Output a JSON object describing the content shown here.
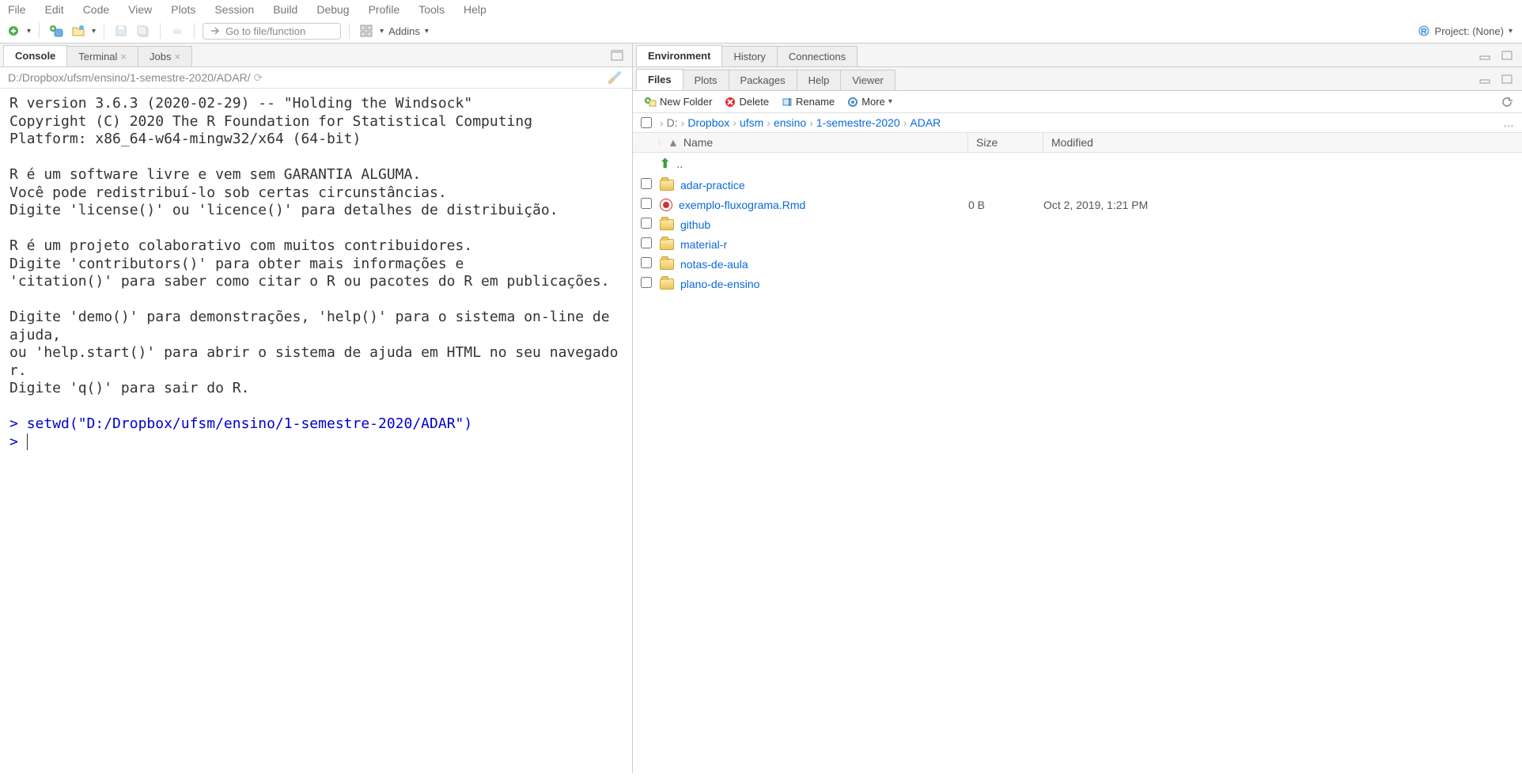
{
  "menubar": [
    "File",
    "Edit",
    "Code",
    "View",
    "Plots",
    "Session",
    "Build",
    "Debug",
    "Profile",
    "Tools",
    "Help"
  ],
  "toolbar": {
    "goto_placeholder": "Go to file/function",
    "addins": "Addins",
    "project": "Project: (None)"
  },
  "left": {
    "tabs": {
      "console": "Console",
      "terminal": "Terminal",
      "jobs": "Jobs"
    },
    "path": "D:/Dropbox/ufsm/ensino/1-semestre-2020/ADAR/",
    "console_text": "R version 3.6.3 (2020-02-29) -- \"Holding the Windsock\"\nCopyright (C) 2020 The R Foundation for Statistical Computing\nPlatform: x86_64-w64-mingw32/x64 (64-bit)\n\nR é um software livre e vem sem GARANTIA ALGUMA.\nVocê pode redistribuí-lo sob certas circunstâncias.\nDigite 'license()' ou 'licence()' para detalhes de distribuição.\n\nR é um projeto colaborativo com muitos contribuidores.\nDigite 'contributors()' para obter mais informações e\n'citation()' para saber como citar o R ou pacotes do R em publicações.\n\nDigite 'demo()' para demonstrações, 'help()' para o sistema on-line de ajuda,\nou 'help.start()' para abrir o sistema de ajuda em HTML no seu navegador.\nDigite 'q()' para sair do R.\n",
    "prompt1": "> ",
    "cmd1": "setwd(\"D:/Dropbox/ufsm/ensino/1-semestre-2020/ADAR\")",
    "prompt2": "> "
  },
  "right": {
    "top_tabs": {
      "env": "Environment",
      "hist": "History",
      "conn": "Connections"
    },
    "bot_tabs": {
      "files": "Files",
      "plots": "Plots",
      "packages": "Packages",
      "help": "Help",
      "viewer": "Viewer"
    },
    "file_btns": {
      "new": "New Folder",
      "delete": "Delete",
      "rename": "Rename",
      "more": "More"
    },
    "breadcrumb": [
      "D:",
      "Dropbox",
      "ufsm",
      "ensino",
      "1-semestre-2020",
      "ADAR"
    ],
    "headers": {
      "name": "Name",
      "size": "Size",
      "modified": "Modified"
    },
    "updir": "..",
    "rows": [
      {
        "type": "folder",
        "name": "adar-practice",
        "size": "",
        "modified": ""
      },
      {
        "type": "rmd",
        "name": "exemplo-fluxograma.Rmd",
        "size": "0 B",
        "modified": "Oct 2, 2019, 1:21 PM"
      },
      {
        "type": "folder",
        "name": "github",
        "size": "",
        "modified": ""
      },
      {
        "type": "folder",
        "name": "material-r",
        "size": "",
        "modified": ""
      },
      {
        "type": "folder",
        "name": "notas-de-aula",
        "size": "",
        "modified": ""
      },
      {
        "type": "folder",
        "name": "plano-de-ensino",
        "size": "",
        "modified": ""
      }
    ]
  }
}
